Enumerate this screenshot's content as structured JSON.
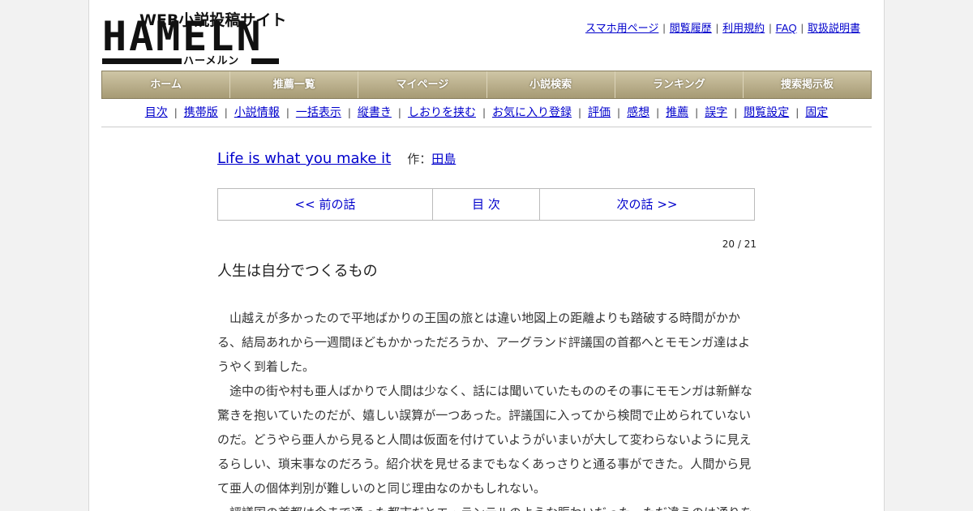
{
  "logo": {
    "tagline": "WEB小説投稿サイト",
    "word": "HAMELN",
    "kana": "ハーメルン"
  },
  "toplinks": [
    {
      "label": "スマホ用ページ"
    },
    {
      "label": "閲覧履歴"
    },
    {
      "label": "利用規約"
    },
    {
      "label": "FAQ"
    },
    {
      "label": "取扱説明書"
    }
  ],
  "nav": [
    {
      "label": "ホーム"
    },
    {
      "label": "推薦一覧"
    },
    {
      "label": "マイページ"
    },
    {
      "label": "小説検索"
    },
    {
      "label": "ランキング"
    },
    {
      "label": "捜索掲示板"
    }
  ],
  "sublinks": [
    {
      "label": "目次"
    },
    {
      "label": "携帯版"
    },
    {
      "label": "小説情報"
    },
    {
      "label": "一括表示"
    },
    {
      "label": "縦書き"
    },
    {
      "label": "しおりを挟む"
    },
    {
      "label": "お気に入り登録"
    },
    {
      "label": "評価"
    },
    {
      "label": "感想"
    },
    {
      "label": "推薦"
    },
    {
      "label": "誤字"
    },
    {
      "label": "閲覧設定"
    },
    {
      "label": "固定"
    }
  ],
  "novel": {
    "title": "Life is what you make it",
    "author_prefix": "作：",
    "author": "田島"
  },
  "pager": {
    "prev": "<< 前の話",
    "toc": "目 次",
    "next": "次の話 >>"
  },
  "page_count": "20 / 21",
  "chapter_title": "人生は自分でつくるもの",
  "paragraphs": [
    "山越えが多かったので平地ばかりの王国の旅とは違い地図上の距離よりも踏破する時間がかかる、結局あれから一週間ほどもかかっただろうか、アーグランド評議国の首都へとモモンガ達はようやく到着した。",
    "途中の街や村も亜人ばかりで人間は少なく、話には聞いていたもののその事にモモンガは新鮮な驚きを抱いていたのだが、嬉しい誤算が一つあった。評議国に入ってから検問で止められていないのだ。どうやら亜人から見ると人間は仮面を付けていようがいまいが大して変わらないように見えるらしい、瑣末事なのだろう。紹介状を見せるまでもなくあっさりと通る事ができた。人間から見て亜人の個体判別が難しいのと同じ理由なのかもしれない。",
    "評議国の首都は今まで通った都市だとエ・ランテルのような賑わいだった。ただ違うのは通りを"
  ]
}
